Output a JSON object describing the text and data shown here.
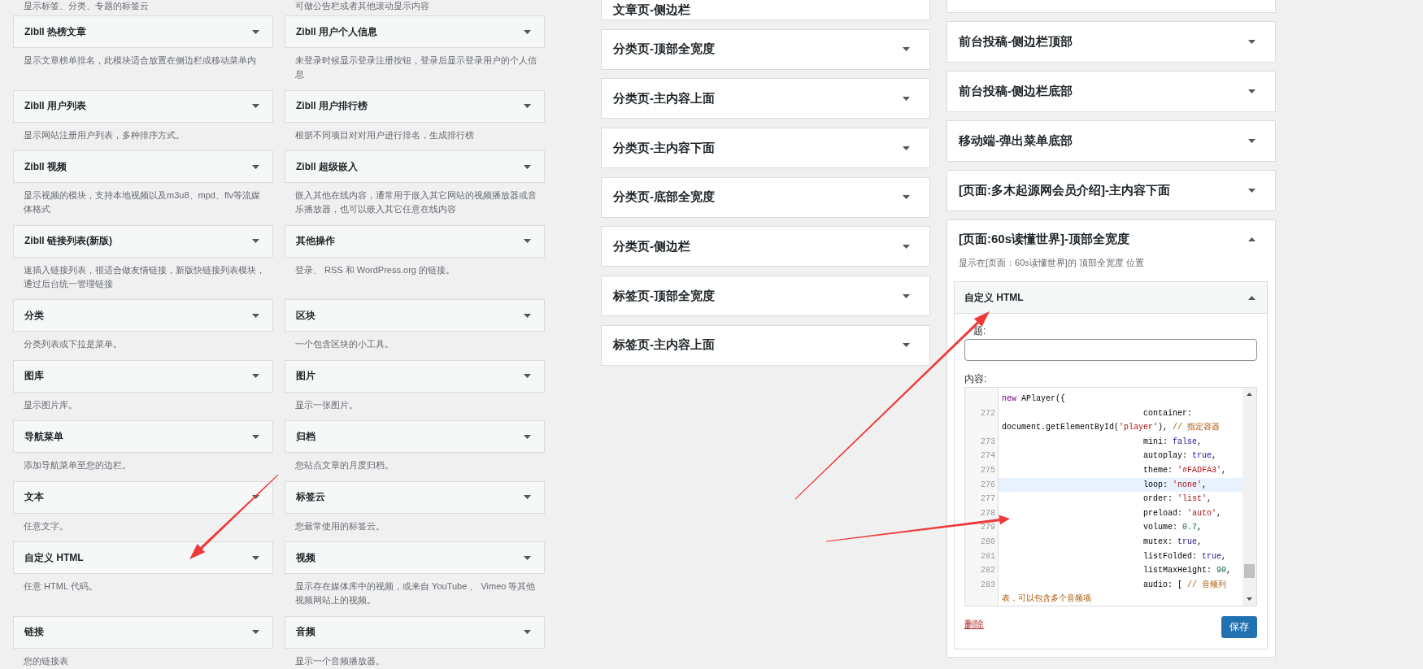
{
  "available_widgets": {
    "clipped_descriptions": [
      "显示标签、分类、专题的标签云",
      "可做公告栏或者其他滚动显示内容"
    ],
    "items": [
      {
        "title": "Zibll 热榜文章",
        "description": "显示文章榜单排名，此模块适合放置在侧边栏或移动菜单内"
      },
      {
        "title": "Zibll 用户个人信息",
        "description": "未登录时候显示登录注册按钮，登录后显示登录用户的个人信息"
      },
      {
        "title": "Zibll 用户列表",
        "description": "显示网站注册用户列表，多种排序方式。"
      },
      {
        "title": "Zibll 用户排行榜",
        "description": "根据不同项目对对用户进行排名，生成排行榜"
      },
      {
        "title": "Zibll 视频",
        "description": "显示视频的模块，支持本地视频以及m3u8、mpd、flv等流媒体格式"
      },
      {
        "title": "Zibll 超级嵌入",
        "description": "嵌入其他在线内容，通常用于嵌入其它网站的视频播放器或音乐播放器，也可以嵌入其它任意在线内容"
      },
      {
        "title": "Zibll 链接列表(新版)",
        "description": "速插入链接列表，很适合做友情链接，新版快链接列表模块，通过后台统一管理链接"
      },
      {
        "title": "其他操作",
        "description": "登录、 RSS 和 WordPress.org 的链接。"
      },
      {
        "title": "分类",
        "description": "分类列表或下拉是菜单。"
      },
      {
        "title": "区块",
        "description": "一个包含区块的小工具。"
      },
      {
        "title": "图库",
        "description": "显示图片库。"
      },
      {
        "title": "图片",
        "description": "显示一张图片。"
      },
      {
        "title": "导航菜单",
        "description": "添加导航菜单至您的边栏。"
      },
      {
        "title": "归档",
        "description": "您站点文章的月度归档。"
      },
      {
        "title": "文本",
        "description": "任意文字。"
      },
      {
        "title": "标签云",
        "description": "您最常使用的标签云。"
      },
      {
        "title": "自定义 HTML",
        "description": "任意 HTML 代码。"
      },
      {
        "title": "视频",
        "description": "显示存在媒体库中的视频，或来自 YouTube 、 Vimeo 等其他视频网站上的视频。"
      },
      {
        "title": "链接",
        "description": "您的链接表"
      },
      {
        "title": "音频",
        "description": "显示一个音频播放器。"
      }
    ]
  },
  "middle_column": [
    {
      "kind": "clipped",
      "title": "文章页-侧边栏"
    },
    {
      "kind": "area",
      "title": "分类页-顶部全宽度",
      "expanded": false
    },
    {
      "kind": "area",
      "title": "分类页-主内容上面",
      "expanded": false
    },
    {
      "kind": "area",
      "title": "分类页-主内容下面",
      "expanded": false
    },
    {
      "kind": "area",
      "title": "分类页-底部全宽度",
      "expanded": false
    },
    {
      "kind": "area",
      "title": "分类页-侧边栏",
      "expanded": false
    },
    {
      "kind": "area",
      "title": "标签页-顶部全宽度",
      "expanded": false
    },
    {
      "kind": "area",
      "title": "标签页-主内容上面",
      "expanded": false
    }
  ],
  "right_column": [
    {
      "kind": "clipped"
    },
    {
      "kind": "area",
      "title": "前台投稿-侧边栏顶部",
      "expanded": false
    },
    {
      "kind": "area",
      "title": "前台投稿-侧边栏底部",
      "expanded": false
    },
    {
      "kind": "area",
      "title": "移动端-弹出菜单底部",
      "expanded": false
    },
    {
      "kind": "area",
      "title": "[页面:多木起源网会员介绍]-主内容下面",
      "expanded": false
    },
    {
      "kind": "area",
      "title": "[页面:60s读懂世界]-顶部全宽度",
      "expanded": true,
      "description": "显示在[页面：60s读懂世界]的 顶部全宽度 位置",
      "widgets": [
        {
          "title": "自定义 HTML",
          "expanded": true,
          "title_field": {
            "label": "题:"
          },
          "content_field": {
            "label": "内容:"
          },
          "code_rows": [
            {
              "tokens": [
                {
                  "kind": "keyword",
                  "text": "new"
                },
                {
                  "kind": "plain",
                  "text": " APlayer({"
                }
              ],
              "active": false
            },
            {
              "number": "272",
              "tokens": [
                {
                  "kind": "plain",
                  "text": "                             container:"
                }
              ],
              "active": false
            },
            {
              "tokens": [
                {
                  "kind": "plain",
                  "text": "document.getElementById("
                },
                {
                  "kind": "string",
                  "text": "'player'"
                },
                {
                  "kind": "plain",
                  "text": "), "
                },
                {
                  "kind": "comment",
                  "text": "// 指定容器"
                }
              ],
              "active": false
            },
            {
              "number": "273",
              "tokens": [
                {
                  "kind": "plain",
                  "text": "                             mini: "
                },
                {
                  "kind": "atom",
                  "text": "false"
                },
                {
                  "kind": "plain",
                  "text": ","
                }
              ],
              "active": false
            },
            {
              "number": "274",
              "tokens": [
                {
                  "kind": "plain",
                  "text": "                             autoplay: "
                },
                {
                  "kind": "atom",
                  "text": "true"
                },
                {
                  "kind": "plain",
                  "text": ","
                }
              ],
              "active": false
            },
            {
              "number": "275",
              "tokens": [
                {
                  "kind": "plain",
                  "text": "                             theme: "
                },
                {
                  "kind": "string",
                  "text": "'#FADFA3'"
                },
                {
                  "kind": "plain",
                  "text": ","
                }
              ],
              "active": false
            },
            {
              "number": "276",
              "tokens": [
                {
                  "kind": "plain",
                  "text": "                             loop: "
                },
                {
                  "kind": "string",
                  "text": "'none'"
                },
                {
                  "kind": "plain",
                  "text": ","
                }
              ],
              "active": true
            },
            {
              "number": "277",
              "tokens": [
                {
                  "kind": "plain",
                  "text": "                             order: "
                },
                {
                  "kind": "string",
                  "text": "'list'"
                },
                {
                  "kind": "plain",
                  "text": ","
                }
              ],
              "active": false
            },
            {
              "number": "278",
              "tokens": [
                {
                  "kind": "plain",
                  "text": "                             preload: "
                },
                {
                  "kind": "string",
                  "text": "'auto'"
                },
                {
                  "kind": "plain",
                  "text": ","
                }
              ],
              "active": false
            },
            {
              "number": "279",
              "tokens": [
                {
                  "kind": "plain",
                  "text": "                             volume: "
                },
                {
                  "kind": "number",
                  "text": "0.7"
                },
                {
                  "kind": "plain",
                  "text": ","
                }
              ],
              "active": false
            },
            {
              "number": "280",
              "tokens": [
                {
                  "kind": "plain",
                  "text": "                             mutex: "
                },
                {
                  "kind": "atom",
                  "text": "true"
                },
                {
                  "kind": "plain",
                  "text": ","
                }
              ],
              "active": false
            },
            {
              "number": "281",
              "tokens": [
                {
                  "kind": "plain",
                  "text": "                             listFolded: "
                },
                {
                  "kind": "atom",
                  "text": "true"
                },
                {
                  "kind": "plain",
                  "text": ","
                }
              ],
              "active": false
            },
            {
              "number": "282",
              "tokens": [
                {
                  "kind": "plain",
                  "text": "                             listMaxHeight: "
                },
                {
                  "kind": "number",
                  "text": "90"
                },
                {
                  "kind": "plain",
                  "text": ","
                }
              ],
              "active": false
            },
            {
              "number": "283",
              "tokens": [
                {
                  "kind": "plain",
                  "text": "                             audio: [ "
                },
                {
                  "kind": "comment",
                  "text": "// 音频列"
                }
              ],
              "active": false
            },
            {
              "tokens": [
                {
                  "kind": "comment",
                  "text": "表，可以包含多个音频项"
                }
              ],
              "active": false
            }
          ],
          "delete_link": "删除",
          "save_button": "保存"
        }
      ]
    }
  ]
}
